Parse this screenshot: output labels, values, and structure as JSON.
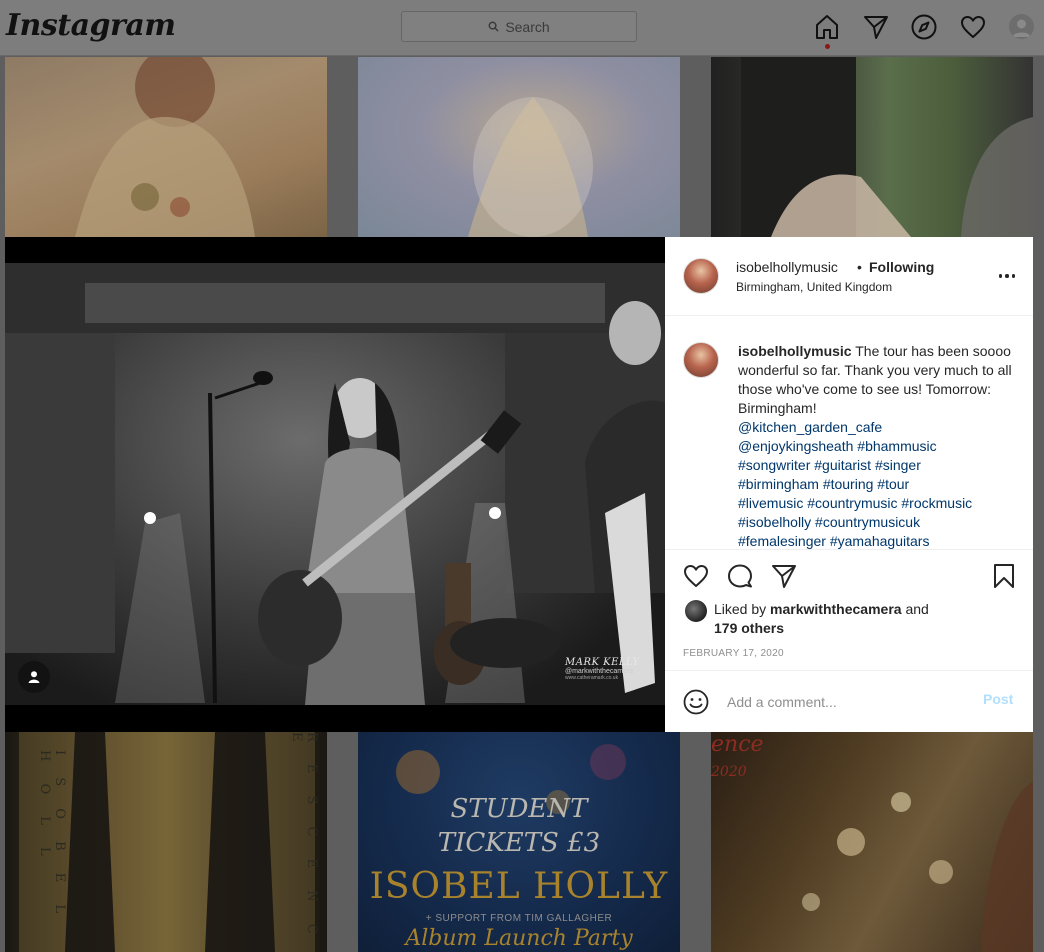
{
  "nav": {
    "logo": "Instagram",
    "search_placeholder": "Search"
  },
  "grid": {
    "bottom_left_letters_a": "I S O B E L   H O L L",
    "bottom_left_letters_b": "R E S C E N C E",
    "bottom_mid": {
      "line1": "STUDENT",
      "line2": "TICKETS £3",
      "line3": "ISOBEL HOLLY",
      "line4": "+ SUPPORT FROM TIM GALLAGHER",
      "line5": "Album Launch Party"
    },
    "bottom_right": {
      "title": "ence",
      "year": "2020"
    }
  },
  "photo": {
    "watermark_name": "MARK KELLY",
    "watermark_handle": "@markwiththecamera",
    "watermark_site": "www.catheramark.co.uk"
  },
  "post": {
    "username": "isobelhollymusic",
    "separator": "•",
    "follow_status": "Following",
    "location": "Birmingham, United Kingdom",
    "caption_user": "isobelhollymusic",
    "caption_text": "The tour has been soooo wonderful so far. Thank you very much to all those who've come to see us! Tomorrow: Birmingham!",
    "tags": [
      "@kitchen_garden_cafe",
      "@enjoykingsheath #bhammusic",
      "#songwriter #guitarist #singer",
      "#birmingham #touring #tour",
      "#livemusic #countrymusic #rockmusic",
      "#isobelholly #countrymusicuk",
      "#femalesinger #yamahaguitars"
    ],
    "liked_prefix": "Liked by",
    "liked_user": "markwiththecamera",
    "liked_and": "and",
    "liked_others": "179 others",
    "date": "FEBRUARY 17, 2020",
    "comment_placeholder": "Add a comment...",
    "post_label": "Post"
  },
  "colors": {
    "link": "#00376b",
    "post_button": "#b2dffc",
    "home_dot": "#ed4956"
  },
  "icons": [
    "search-icon",
    "home-icon",
    "direct-icon",
    "explore-icon",
    "activity-icon",
    "profile-avatar",
    "user-tag-icon",
    "more-icon",
    "like-icon",
    "comment-icon",
    "share-icon",
    "save-icon",
    "emoji-icon"
  ]
}
